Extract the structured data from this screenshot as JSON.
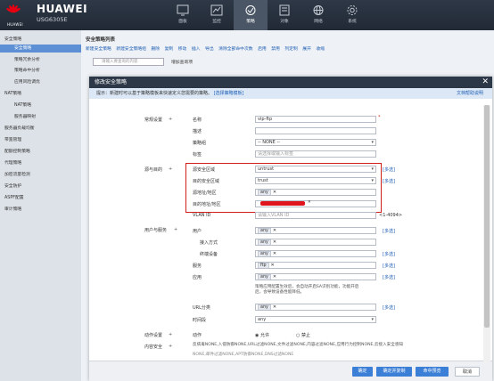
{
  "brand": {
    "name": "HUAWEI",
    "model": "USG6305E",
    "label": "HUAWEI"
  },
  "nav": [
    {
      "label": "面板",
      "icon": "dashboard-icon"
    },
    {
      "label": "监控",
      "icon": "monitor-icon"
    },
    {
      "label": "策略",
      "icon": "policy-icon"
    },
    {
      "label": "对象",
      "icon": "object-icon"
    },
    {
      "label": "网络",
      "icon": "network-icon"
    },
    {
      "label": "系统",
      "icon": "system-icon"
    }
  ],
  "sidebar": {
    "items": [
      "安全策略",
      "安全策略",
      "策略冗余分析",
      "策略命中分析",
      "应用风险调优",
      "NAT策略",
      "NAT策略",
      "服务器映射",
      "服务器负载均衡",
      "带宽管理",
      "配额控制策略",
      "代理策略",
      "加密流量检测",
      "安全防护",
      "ASPF配置",
      "审计策略"
    ]
  },
  "page": {
    "crumb": "安全策略列表",
    "toolbar": [
      "新建安全策略",
      "新建安全策略组",
      "删除",
      "复制",
      "移动",
      "插入",
      "导出",
      "清除全部命中次数",
      "启用",
      "禁用",
      "列定制",
      "展开",
      "收缩"
    ],
    "search_placeholder": "请输入要查询的内容",
    "add_condition": "增加查询项"
  },
  "modal": {
    "title": "修改安全策略",
    "tip": "提示：新建时可以基于策略模板来快速定义您需要的策略。",
    "tip_link": "[选择策略模板]",
    "help_link": "文档帮助说明",
    "sections": {
      "basic": "常规设置",
      "src_dst": "源与目的",
      "user_service": "用户与服务",
      "action_setting": "动作设置",
      "content_security": "内容安全"
    },
    "fields": {
      "name_label": "名称",
      "name_value": "vip-ftp",
      "desc_label": "描述",
      "group_label": "策略组",
      "group_value": "-- NONE --",
      "tag_label": "标签",
      "tag_placeholder": "请选择或输入标签",
      "src_zone_label": "源安全区域",
      "src_zone_value": "untrust",
      "dst_zone_label": "目的安全区域",
      "dst_zone_value": "trust",
      "src_addr_label": "源地址/地区",
      "src_addr_tag": "any",
      "dst_addr_label": "目的地址/地区",
      "vlan_label": "VLAN ID",
      "vlan_placeholder": "请输入VLAN ID",
      "vlan_range": "<1-4094>",
      "user_label": "用户",
      "user_tag": "any",
      "access_label": "接入方式",
      "access_tag": "any",
      "terminal_label": "终端设备",
      "terminal_tag": "any",
      "service_label": "服务",
      "service_tag": "ftp",
      "app_label": "应用",
      "app_tag": "any",
      "app_note_1": "策略应用配置生效后，会自动开启SA识别功能，功能开启",
      "app_note_2": "后，会导致设备性能降低。",
      "url_label": "URL分类",
      "url_tag": "any",
      "time_label": "时间段",
      "time_value": "any",
      "action_label": "动作",
      "action_permit": "允许",
      "action_deny": "禁止",
      "content_summary": "反病毒NONE,入侵防御NONE,URL过滤NONE,文件过滤NONE,内容过滤NONE,应用行为控制NONE,云接入安全感知",
      "content_summary_2": "NONE,邮件过滤NONE,APT防御NONE,DNS过滤NONE"
    },
    "multi_select": "[多选]",
    "buttons": {
      "ok": "确定",
      "ok_copy": "确定并复制",
      "hit_preview": "命中预览",
      "cancel": "取消"
    }
  },
  "colors": {
    "topbar": "#2b3543",
    "accent": "#3c7fd6",
    "highlight": "#d0201a"
  }
}
